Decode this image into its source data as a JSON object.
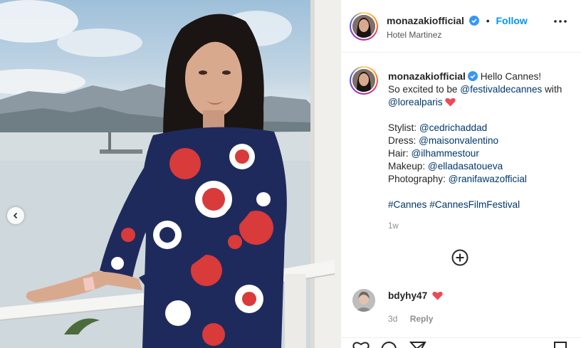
{
  "post": {
    "username": "monazakiofficial",
    "follow_label": "Follow",
    "location": "Hotel Martinez",
    "caption": {
      "username": "monazakiofficial",
      "line1": "Hello Cannes!",
      "line2_pre": "So excited to be ",
      "line2_mention": "@festivaldecannes",
      "line2_post": " with",
      "line3_mention": "@lorealparis",
      "credits": [
        {
          "label": "Stylist: ",
          "mention": "@cedrichaddad"
        },
        {
          "label": "Dress: ",
          "mention": "@maisonvalentino"
        },
        {
          "label": "Hair: ",
          "mention": "@ilhammestour"
        },
        {
          "label": "Makeup: ",
          "mention": "@elladasatoueva"
        },
        {
          "label": "Photography: ",
          "mention": "@ranifawazofficial"
        }
      ],
      "hashtag1": "#Cannes",
      "hashtag2": "#CannesFilmFestival"
    },
    "time_ago": "1w"
  },
  "comment": {
    "username": "bdyhy47",
    "time": "3d",
    "reply_label": "Reply"
  },
  "colors": {
    "link": "#0095f6",
    "mention": "#00376b",
    "heart": "#ed4956",
    "verified": "#3897f0"
  },
  "icons": {
    "verified": "verified-badge-icon",
    "more": "more-options-icon",
    "heart": "red-heart-icon",
    "load_more": "plus-circle-icon",
    "prev": "chevron-left-icon"
  }
}
